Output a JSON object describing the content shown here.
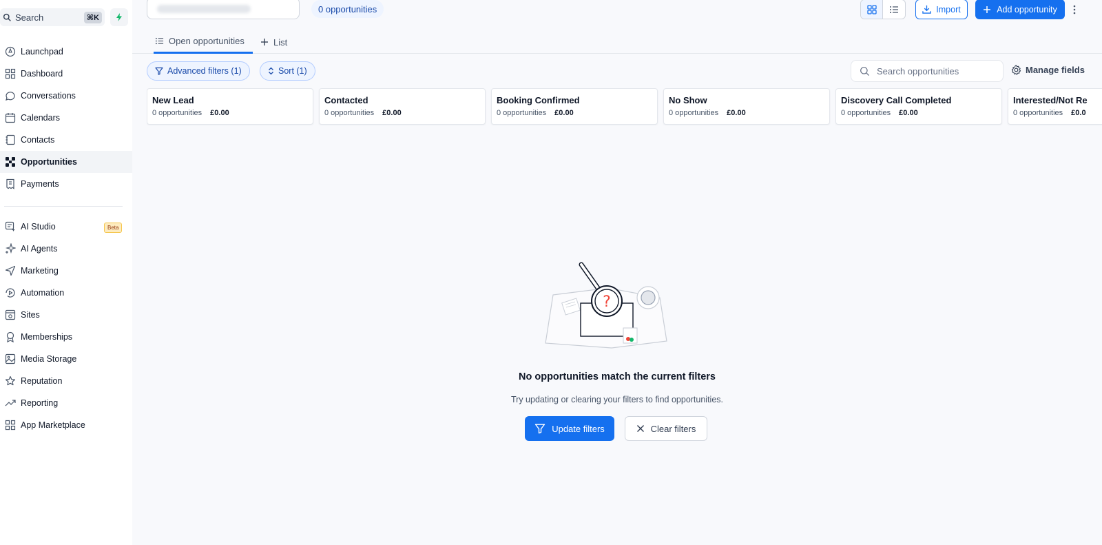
{
  "sidebar": {
    "search_label": "Search",
    "search_shortcut": "⌘K",
    "items": [
      {
        "label": "Launchpad",
        "icon": "launchpad-icon"
      },
      {
        "label": "Dashboard",
        "icon": "dashboard-icon"
      },
      {
        "label": "Conversations",
        "icon": "chat-bubble-icon"
      },
      {
        "label": "Calendars",
        "icon": "calendar-icon"
      },
      {
        "label": "Contacts",
        "icon": "contacts-icon"
      },
      {
        "label": "Opportunities",
        "icon": "opportunities-icon",
        "active": true
      },
      {
        "label": "Payments",
        "icon": "payments-icon"
      },
      {
        "label": "AI Studio",
        "icon": "ai-studio-icon",
        "badge": "Beta"
      },
      {
        "label": "AI Agents",
        "icon": "sparkle-icon"
      },
      {
        "label": "Marketing",
        "icon": "send-icon"
      },
      {
        "label": "Automation",
        "icon": "automation-icon"
      },
      {
        "label": "Sites",
        "icon": "sites-icon"
      },
      {
        "label": "Memberships",
        "icon": "award-icon"
      },
      {
        "label": "Media Storage",
        "icon": "image-icon"
      },
      {
        "label": "Reputation",
        "icon": "star-icon"
      },
      {
        "label": "Reporting",
        "icon": "trend-icon"
      },
      {
        "label": "App Marketplace",
        "icon": "grid-icon"
      }
    ]
  },
  "header": {
    "opportunities_count": "0 opportunities",
    "import_label": "Import",
    "add_label": "Add opportunity"
  },
  "tabs": {
    "open_label": "Open opportunities",
    "list_label": "List"
  },
  "toolbar": {
    "filters_label": "Advanced filters (1)",
    "sort_label": "Sort (1)",
    "search_placeholder": "Search opportunities",
    "manage_fields_label": "Manage fields"
  },
  "stages": [
    {
      "name": "New Lead",
      "count": "0 opportunities",
      "amount": "£0.00"
    },
    {
      "name": "Contacted",
      "count": "0 opportunities",
      "amount": "£0.00"
    },
    {
      "name": "Booking Confirmed",
      "count": "0 opportunities",
      "amount": "£0.00"
    },
    {
      "name": "No Show",
      "count": "0 opportunities",
      "amount": "£0.00"
    },
    {
      "name": "Discovery Call Completed",
      "count": "0 opportunities",
      "amount": "£0.00"
    },
    {
      "name": "Interested/Not Re",
      "count": "0 opportunities",
      "amount": "£0.0"
    }
  ],
  "empty_state": {
    "title": "No opportunities match the current filters",
    "subtitle": "Try updating or clearing your filters to find opportunities.",
    "update_label": "Update filters",
    "clear_label": "Clear filters"
  },
  "colors": {
    "primary": "#1570ef",
    "chip_bg": "#eef4ff",
    "chip_text": "#1849a9",
    "bolt": "#12b76a"
  }
}
